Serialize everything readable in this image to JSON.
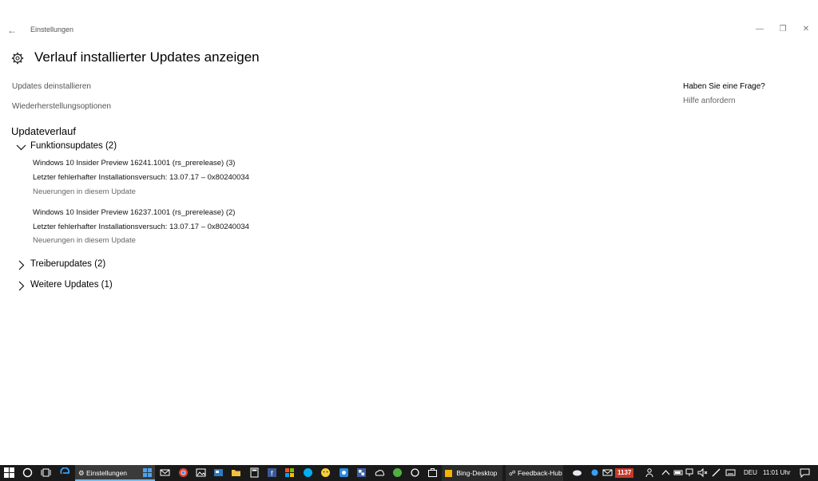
{
  "window": {
    "title": "Einstellungen",
    "back_glyph": "←",
    "min_glyph": "—",
    "max_glyph": "❐",
    "close_glyph": "✕"
  },
  "page": {
    "title": "Verlauf installierter Updates anzeigen",
    "links": {
      "uninstall": "Updates deinstallieren",
      "recovery": "Wiederherstellungsoptionen"
    },
    "section_title": "Updateverlauf"
  },
  "groups": {
    "feature": {
      "label": "Funktionsupdates (2)",
      "expanded": true,
      "items": [
        {
          "name": "Windows 10 Insider Preview 16241.1001 (rs_prerelease) (3)",
          "status": "Letzter fehlerhafter Installationsversuch: 13.07.17 – 0x80240034",
          "link": "Neuerungen in diesem Update"
        },
        {
          "name": "Windows 10 Insider Preview 16237.1001 (rs_prerelease) (2)",
          "status": "Letzter fehlerhafter Installationsversuch: 13.07.17 – 0x80240034",
          "link": "Neuerungen in diesem Update"
        }
      ]
    },
    "driver": {
      "label": "Treiberupdates (2)",
      "expanded": false
    },
    "other": {
      "label": "Weitere Updates (1)",
      "expanded": false
    }
  },
  "help": {
    "question": "Haben Sie eine Frage?",
    "link": "Hilfe anfordern"
  },
  "taskbar": {
    "apps": {
      "settings": "Einstellungen",
      "bing": "Bing-Desktop",
      "feedback": "Feedback-Hub"
    },
    "mail_badge": "1137",
    "language": "DEU",
    "clock": "11:01 Uhr",
    "accent_color": "#76b9ed",
    "badge_color": "#c8382a"
  }
}
